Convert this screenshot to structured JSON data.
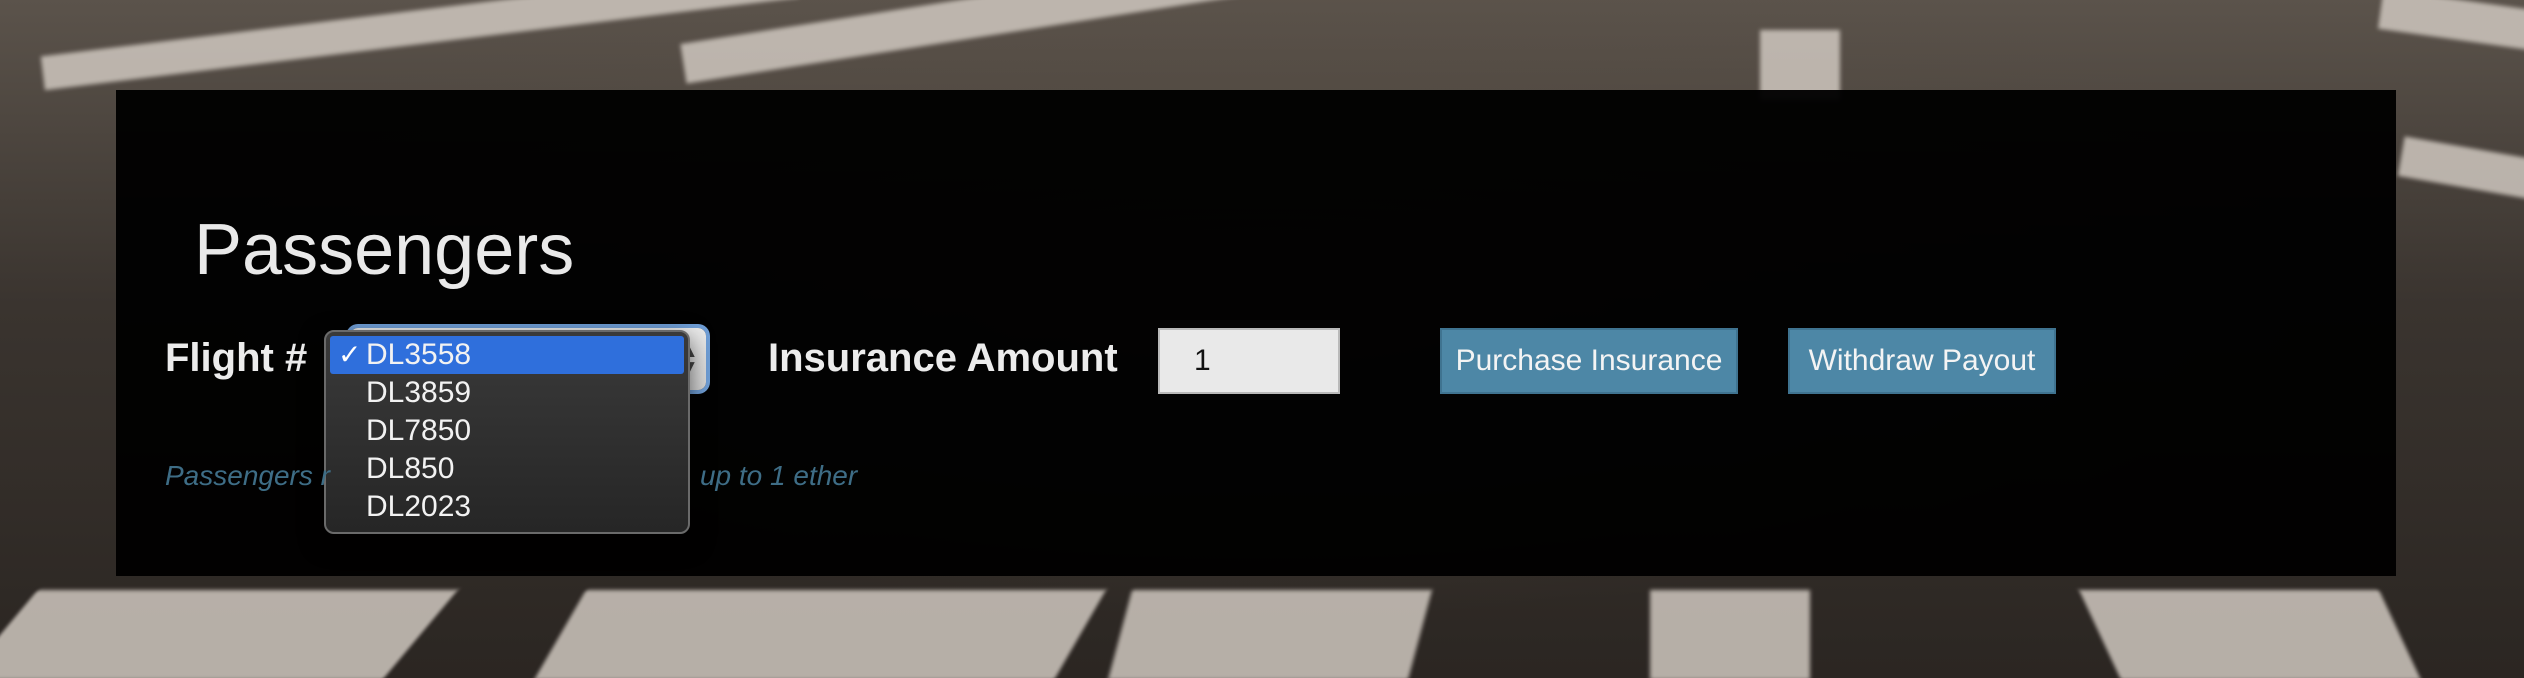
{
  "section": {
    "title": "Passengers"
  },
  "form": {
    "flight_label": "Flight #",
    "flight_options": [
      "DL3558",
      "DL3859",
      "DL7850",
      "DL850",
      "DL2023"
    ],
    "flight_selected": "DL3558",
    "amount_label": "Insurance Amount",
    "amount_value": "1",
    "purchase_label": "Purchase Insurance",
    "withdraw_label": "Withdraw Payout"
  },
  "hint": {
    "text_left": "Passengers r",
    "text_right": "up to 1 ether"
  },
  "colors": {
    "accent_button": "#4d87a6",
    "selected_option": "#2f6fdc",
    "hint_text": "#3e6d86"
  }
}
